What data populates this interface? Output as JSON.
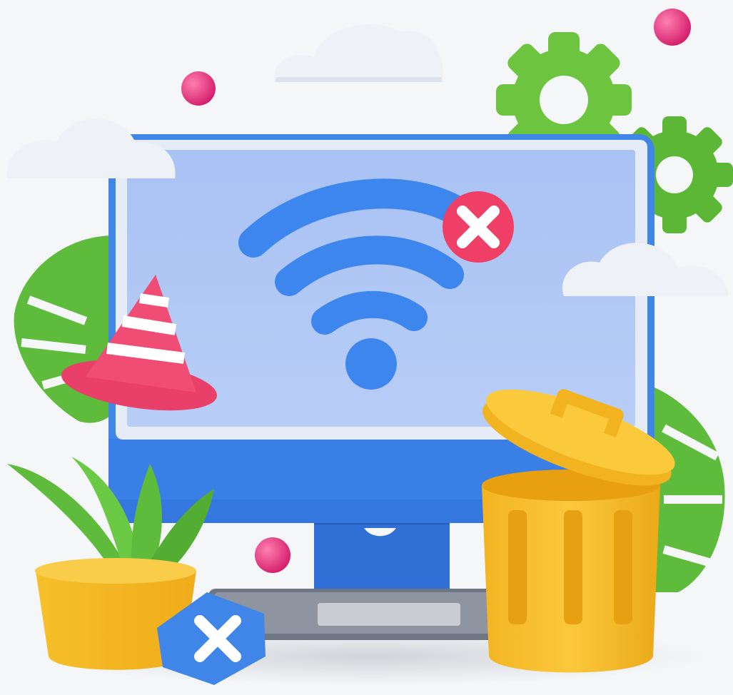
{
  "scene": {
    "subject": "monitor-no-wifi",
    "icons": [
      "cloud-icon",
      "gear-icon",
      "wifi-icon",
      "error-x-icon",
      "traffic-cone-icon",
      "monstera-leaf-icon",
      "potted-plant-icon",
      "trash-can-icon",
      "keyboard-icon",
      "ball-icon"
    ]
  },
  "colors": {
    "background": "#f5f6f8",
    "monitor_frame": "#3f86e8",
    "monitor_chin": "#3a7fe6",
    "screen": "#aac3f4",
    "wifi": "#3d86ee",
    "error_badge": "#ef3f66",
    "cone_red": "#ef4d74",
    "leaf_green": "#5fbb3c",
    "gear_green": "#6cc43f",
    "trash_yellow": "#f8bd2c",
    "pot_yellow": "#f6c232",
    "ball_pink": "#e22b77",
    "cloud": "#eef1f6",
    "keyboard": "#8e95a0"
  }
}
